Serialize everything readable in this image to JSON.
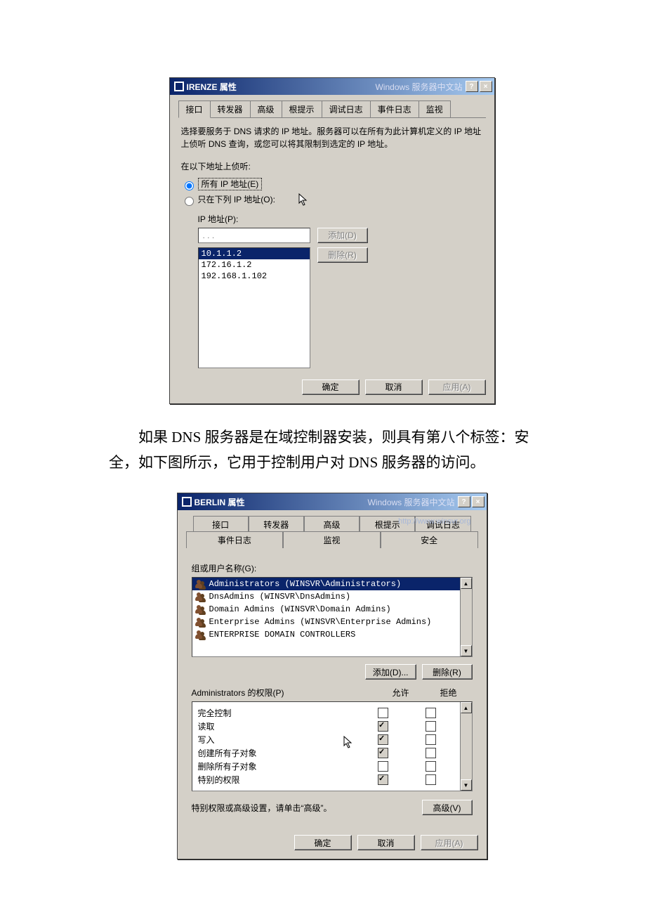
{
  "dialog1": {
    "title": "IRENZE 属性",
    "watermark": "Windows 服务器中文站",
    "help_btn": "?",
    "close_btn": "×",
    "tabs": [
      "接口",
      "转发器",
      "高级",
      "根提示",
      "调试日志",
      "事件日志",
      "监视"
    ],
    "active_tab": 0,
    "description": "选择要服务于 DNS 请求的 IP 地址。服务器可以在所有为此计算机定义的 IP 地址上侦听 DNS 查询，或您可以将其限制到选定的 IP 地址。",
    "listen_label": "在以下地址上侦听:",
    "radio_all": "所有 IP 地址(E)",
    "radio_only": "只在下列 IP 地址(O):",
    "ip_label": "IP 地址(P):",
    "ip_placeholder": " .   .   . ",
    "add_btn": "添加(D)",
    "remove_btn": "删除(R)",
    "ip_list": [
      "10.1.1.2",
      "172.16.1.2",
      "192.168.1.102"
    ],
    "ip_selected": 0,
    "ok": "确定",
    "cancel": "取消",
    "apply": "应用(A)"
  },
  "paragraph": "　　如果 DNS 服务器是在域控制器安装，则具有第八个标签：安全，如下图所示，它用于控制用户对 DNS 服务器的访问。",
  "dialog2": {
    "title": "BERLIN 属性",
    "watermark": "Windows 服务器中文站",
    "watermark2": "http://www.winsvr.org",
    "help_btn": "?",
    "close_btn": "×",
    "tabs_row1": [
      "接口",
      "转发器",
      "高级",
      "根提示",
      "调试日志"
    ],
    "tabs_row2": [
      "事件日志",
      "监视",
      "安全"
    ],
    "active_tab": "安全",
    "group_label": "组或用户名称(G):",
    "users": [
      "Administrators (WINSVR\\Administrators)",
      "DnsAdmins (WINSVR\\DnsAdmins)",
      "Domain Admins (WINSVR\\Domain Admins)",
      "Enterprise Admins (WINSVR\\Enterprise Admins)",
      "ENTERPRISE DOMAIN CONTROLLERS"
    ],
    "user_selected": 0,
    "add_btn": "添加(D)...",
    "remove_btn": "删除(R)",
    "perm_label": "Administrators 的权限(P)",
    "allow_hdr": "允许",
    "deny_hdr": "拒绝",
    "permissions": [
      {
        "name": "完全控制",
        "allow": false,
        "allow_gray": false,
        "deny": false
      },
      {
        "name": "读取",
        "allow": true,
        "allow_gray": true,
        "deny": false
      },
      {
        "name": "写入",
        "allow": true,
        "allow_gray": true,
        "deny": false
      },
      {
        "name": "创建所有子对象",
        "allow": true,
        "allow_gray": true,
        "deny": false
      },
      {
        "name": "删除所有子对象",
        "allow": false,
        "allow_gray": false,
        "deny": false
      },
      {
        "name": "特别的权限",
        "allow": true,
        "allow_gray": true,
        "deny": false
      }
    ],
    "advanced_text": "特别权限或高级设置，请单击“高级”。",
    "advanced_btn": "高级(V)",
    "ok": "确定",
    "cancel": "取消",
    "apply": "应用(A)"
  }
}
